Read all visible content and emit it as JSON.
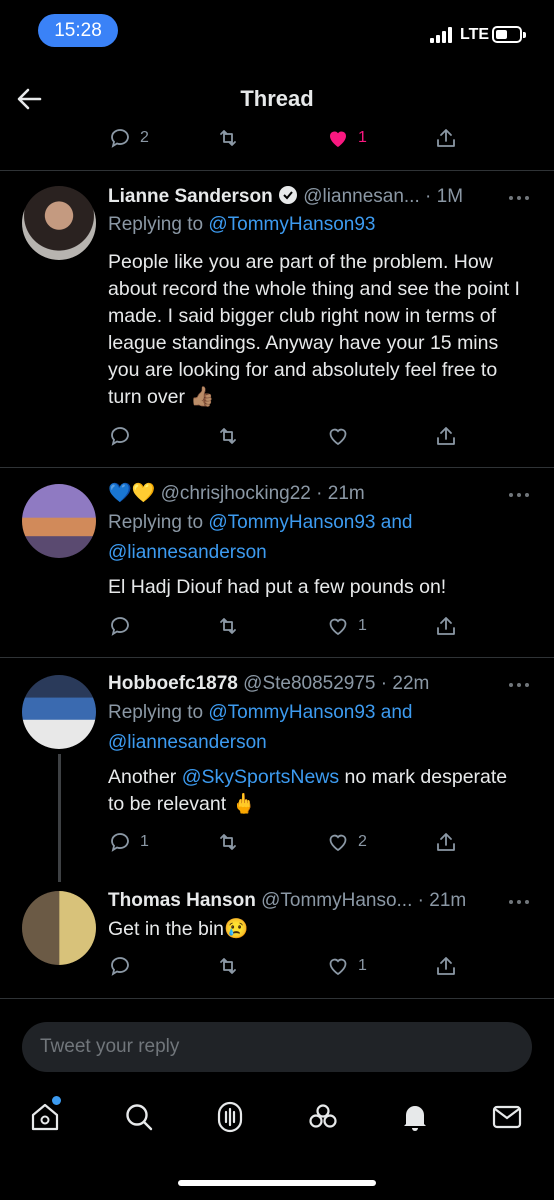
{
  "status_bar": {
    "time": "15:28",
    "network": "LTE"
  },
  "header": {
    "title": "Thread"
  },
  "top_actions": {
    "reply_count": "2",
    "like_count": "1"
  },
  "tweets": [
    {
      "name": "Lianne Sanderson",
      "handle": "@liannesan...",
      "time": "· 1M",
      "replying_prefix": "Replying to ",
      "replying_to": "@TommyHanson93",
      "text": "People like you are part of the problem. How about record the whole thing and see the point I made.  I said bigger club right now in terms of league standings. Anyway have your 15 mins you are looking for and absolutely feel free to turn over 👍🏽",
      "reply_count": "",
      "like_count": ""
    },
    {
      "name": "💙💛",
      "handle": "@chrisjhocking22",
      "time": "· 21m",
      "replying_prefix": "Replying to ",
      "replying_to": "@TommyHanson93 and",
      "replying_to_2": "@liannesanderson",
      "text": "El Hadj Diouf had put a few pounds on!",
      "reply_count": "",
      "like_count": "1"
    },
    {
      "name": "Hobboefc1878",
      "handle": "@Ste80852975",
      "time": "· 22m",
      "replying_prefix": "Replying to ",
      "replying_to": "@TommyHanson93 and",
      "replying_to_2": "@liannesanderson",
      "text_before": "Another ",
      "text_mention": "@SkySportsNews",
      "text_after": " no mark desperate to be relevant 🖕",
      "reply_count": "1",
      "like_count": "2"
    },
    {
      "name": "Thomas Hanson",
      "handle": "@TommyHanso...",
      "time": "· 21m",
      "text": "Get in the bin😢",
      "reply_count": "",
      "like_count": "1"
    }
  ],
  "reply_box": {
    "placeholder": "Tweet your reply"
  },
  "colors": {
    "accent": "#3d9bf0",
    "like": "#f91880",
    "muted": "#8b98a5",
    "background": "#000000"
  }
}
